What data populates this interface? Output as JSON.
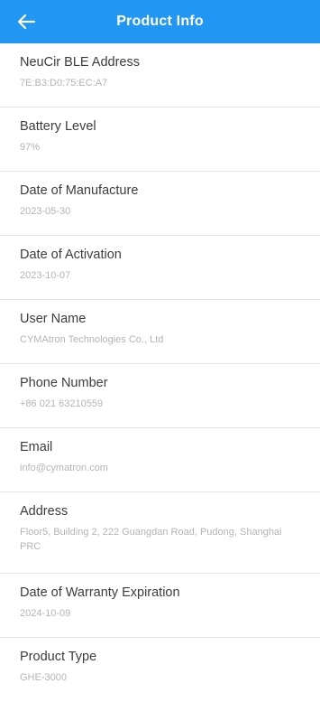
{
  "header": {
    "title": "Product Info",
    "bar_color": "#2196f3",
    "back_icon": "arrow-left-icon"
  },
  "fields": {
    "ble_address": {
      "label": "NeuCir BLE Address",
      "value": "7E:B3:D0:75:EC:A7"
    },
    "battery_level": {
      "label": "Battery Level",
      "value": "97%"
    },
    "manufacture_date": {
      "label": "Date of Manufacture",
      "value": "2023-05-30"
    },
    "activation_date": {
      "label": "Date of Activation",
      "value": "2023-10-07"
    },
    "user_name": {
      "label": "User Name",
      "value": "CYMAtron Technologies Co., Ltd"
    },
    "phone_number": {
      "label": "Phone Number",
      "value": "+86 021 63210559"
    },
    "email": {
      "label": "Email",
      "value": "info@cymatron.com"
    },
    "address": {
      "label": "Address",
      "value": "Floor5, Building 2, 222 Guangdan Road, Pudong, Shanghai PRC"
    },
    "warranty_expiration": {
      "label": "Date of Warranty Expiration",
      "value": "2024-10-09"
    },
    "product_type": {
      "label": "Product Type",
      "value": "GHE-3000"
    }
  }
}
